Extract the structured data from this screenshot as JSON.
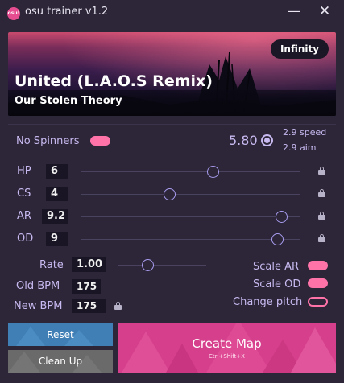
{
  "window": {
    "logo_text": "osu!",
    "title": "osu trainer v1.2",
    "minimize_symbol": "—",
    "close_symbol": "✕"
  },
  "beatmap": {
    "difficulty_name": "Infinity",
    "title": "United (L.A.O.S Remix)",
    "artist": "Our Stolen Theory"
  },
  "mods": {
    "no_spinners_label": "No Spinners",
    "no_spinners_on": true
  },
  "difficulty": {
    "stars": "5.80",
    "speed": "2.9 speed",
    "aim": "2.9 aim"
  },
  "stats": [
    {
      "label": "HP",
      "value": "6",
      "slider_fraction": 0.6
    },
    {
      "label": "CS",
      "value": "4",
      "slider_fraction": 0.4
    },
    {
      "label": "AR",
      "value": "9.2",
      "slider_fraction": 0.92
    },
    {
      "label": "OD",
      "value": "9",
      "slider_fraction": 0.9
    }
  ],
  "rate": {
    "label": "Rate",
    "value": "1.00",
    "old_bpm_label": "Old BPM",
    "old_bpm": "175",
    "new_bpm_label": "New BPM",
    "new_bpm": "175"
  },
  "options": [
    {
      "label": "Scale AR",
      "on": true
    },
    {
      "label": "Scale OD",
      "on": true
    },
    {
      "label": "Change pitch",
      "on": false
    }
  ],
  "buttons": {
    "reset": "Reset",
    "clean_up": "Clean Up",
    "create_map": "Create Map",
    "create_shortcut": "Ctrl+Shift+X"
  },
  "colors": {
    "accent_pink": "#ff73a8",
    "text_lavender": "#c8b9f0",
    "reset_blue": "#3f7fb5",
    "create_pink": "#d63f8c",
    "background": "#2c2638"
  },
  "icons": [
    "app-logo",
    "star-rating-icon",
    "lock-icon",
    "minimize-icon",
    "close-icon"
  ]
}
